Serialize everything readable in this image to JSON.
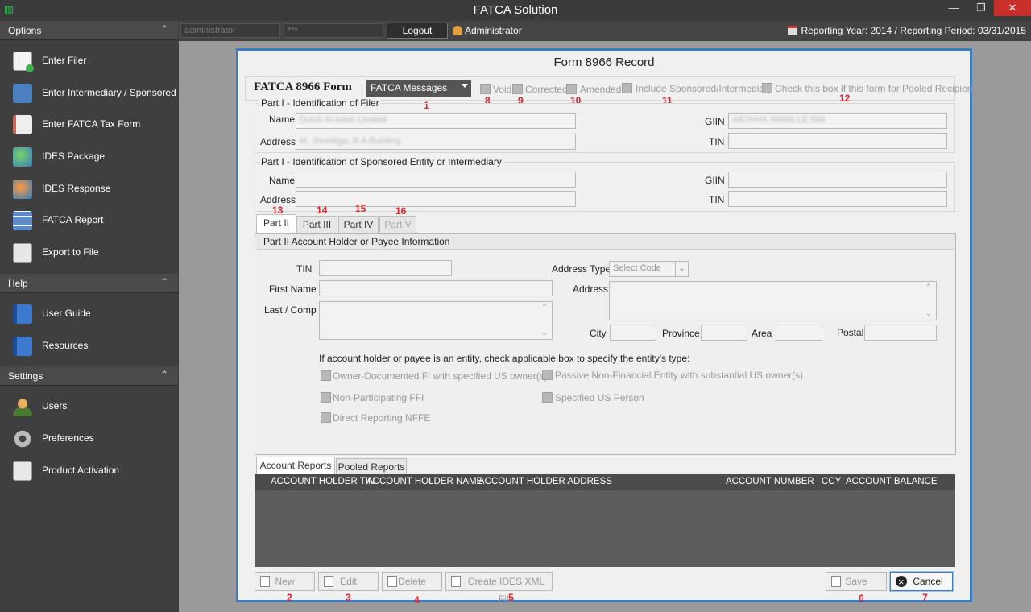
{
  "window": {
    "title": "FATCA Solution"
  },
  "toolbar": {
    "username_field": "administrator",
    "password_field": "***",
    "logout_label": "Logout",
    "user_label": "Administrator",
    "reporting": "Reporting Year: 2014 / Reporting Period: 03/31/2015"
  },
  "sidebar": {
    "options_header": "Options",
    "options": [
      {
        "label": "Enter Filer",
        "icon": "add-document-icon"
      },
      {
        "label": "Enter Intermediary / Sponsored",
        "icon": "id-card-icon"
      },
      {
        "label": "Enter FATCA Tax Form",
        "icon": "form-edit-icon"
      },
      {
        "label": "IDES Package",
        "icon": "globe-icon"
      },
      {
        "label": "IDES Response",
        "icon": "globe-refresh-icon"
      },
      {
        "label": "FATCA Report",
        "icon": "grid-report-icon"
      },
      {
        "label": "Export to File",
        "icon": "xls-file-icon"
      }
    ],
    "help_header": "Help",
    "help": [
      {
        "label": "User Guide",
        "icon": "book-icon"
      },
      {
        "label": "Resources",
        "icon": "book-icon"
      }
    ],
    "settings_header": "Settings",
    "settings": [
      {
        "label": "Users",
        "icon": "users-icon"
      },
      {
        "label": "Preferences",
        "icon": "gear-icon"
      },
      {
        "label": "Product Activation",
        "icon": "activation-icon"
      }
    ]
  },
  "dialog": {
    "title": "Form 8966 Record",
    "form_title": "FATCA 8966 Form",
    "messages_combo": "FATCA Messages",
    "checks": {
      "void": "Void",
      "corrected": "Corrected",
      "amended": "Amended",
      "include_sponsored": "Include Sponsored/Intermediary",
      "pooled": "Check this box if this form for Pooled Recipient"
    },
    "markers": {
      "m1": "1",
      "m2": "2",
      "m3": "3",
      "m4": "4",
      "m5": "5",
      "m6": "6",
      "m7": "7",
      "m8": "8",
      "m9": "9",
      "m10": "10",
      "m11": "11",
      "m12": "12",
      "m13": "13",
      "m14": "14",
      "m15": "15",
      "m16": "16"
    },
    "part1_filer": {
      "title": "Part I - Identification of Filer",
      "name_label": "Name",
      "name_value": "Dutch Al Adah Limited",
      "address_label": "Address",
      "address_value": "M, Jhundiga, B.A Building",
      "giin_label": "GIIN",
      "giin_value": "AB7HHX.99999.LE.586",
      "tin_label": "TIN"
    },
    "part1_sponsored": {
      "title": "Part I - Identification of Sponsored Entity or Intermediary",
      "name_label": "Name",
      "address_label": "Address",
      "giin_label": "GIIN",
      "tin_label": "TIN"
    },
    "tabs": [
      "Part II",
      "Part III",
      "Part IV",
      "Part V"
    ],
    "part2": {
      "title": "Part II Account Holder or Payee Information",
      "tin_label": "TIN",
      "first_name_label": "First Name",
      "last_comp_label": "Last / Comp",
      "address_type_label": "Address Type",
      "address_type_value": "Select Code",
      "address_label": "Address",
      "city_label": "City",
      "province_label": "Province",
      "area_label": "Area",
      "postal_label": "Postal",
      "entity_note": "If account holder or payee is an entity, check applicable box to specify the entity's type:",
      "entity_types": [
        "Owner-Documented FI with specified US owner(s)",
        "Non-Participating FFI",
        "Direct Reporting NFFE",
        "Passive Non-Financial Entity with substantial US owner(s)",
        "Specified US Person"
      ]
    },
    "report_tabs": [
      "Account Reports",
      "Pooled Reports"
    ],
    "columns": [
      "ACCOUNT HOLDER TIN",
      "ACCOUNT HOLDER NAME",
      "ACCOUNT HOLDER ADDRESS",
      "ACCOUNT NUMBER",
      "CCY",
      "ACCOUNT BALANCE"
    ],
    "buttons": {
      "new": "New",
      "edit": "Edit",
      "delete": "Delete",
      "create_xml": "Create IDES XML File",
      "save": "Save",
      "cancel": "Cancel"
    }
  },
  "colors": {
    "accent": "#3a7cc8",
    "marker": "#d9242a",
    "sidebar": "#3f3f3f"
  }
}
